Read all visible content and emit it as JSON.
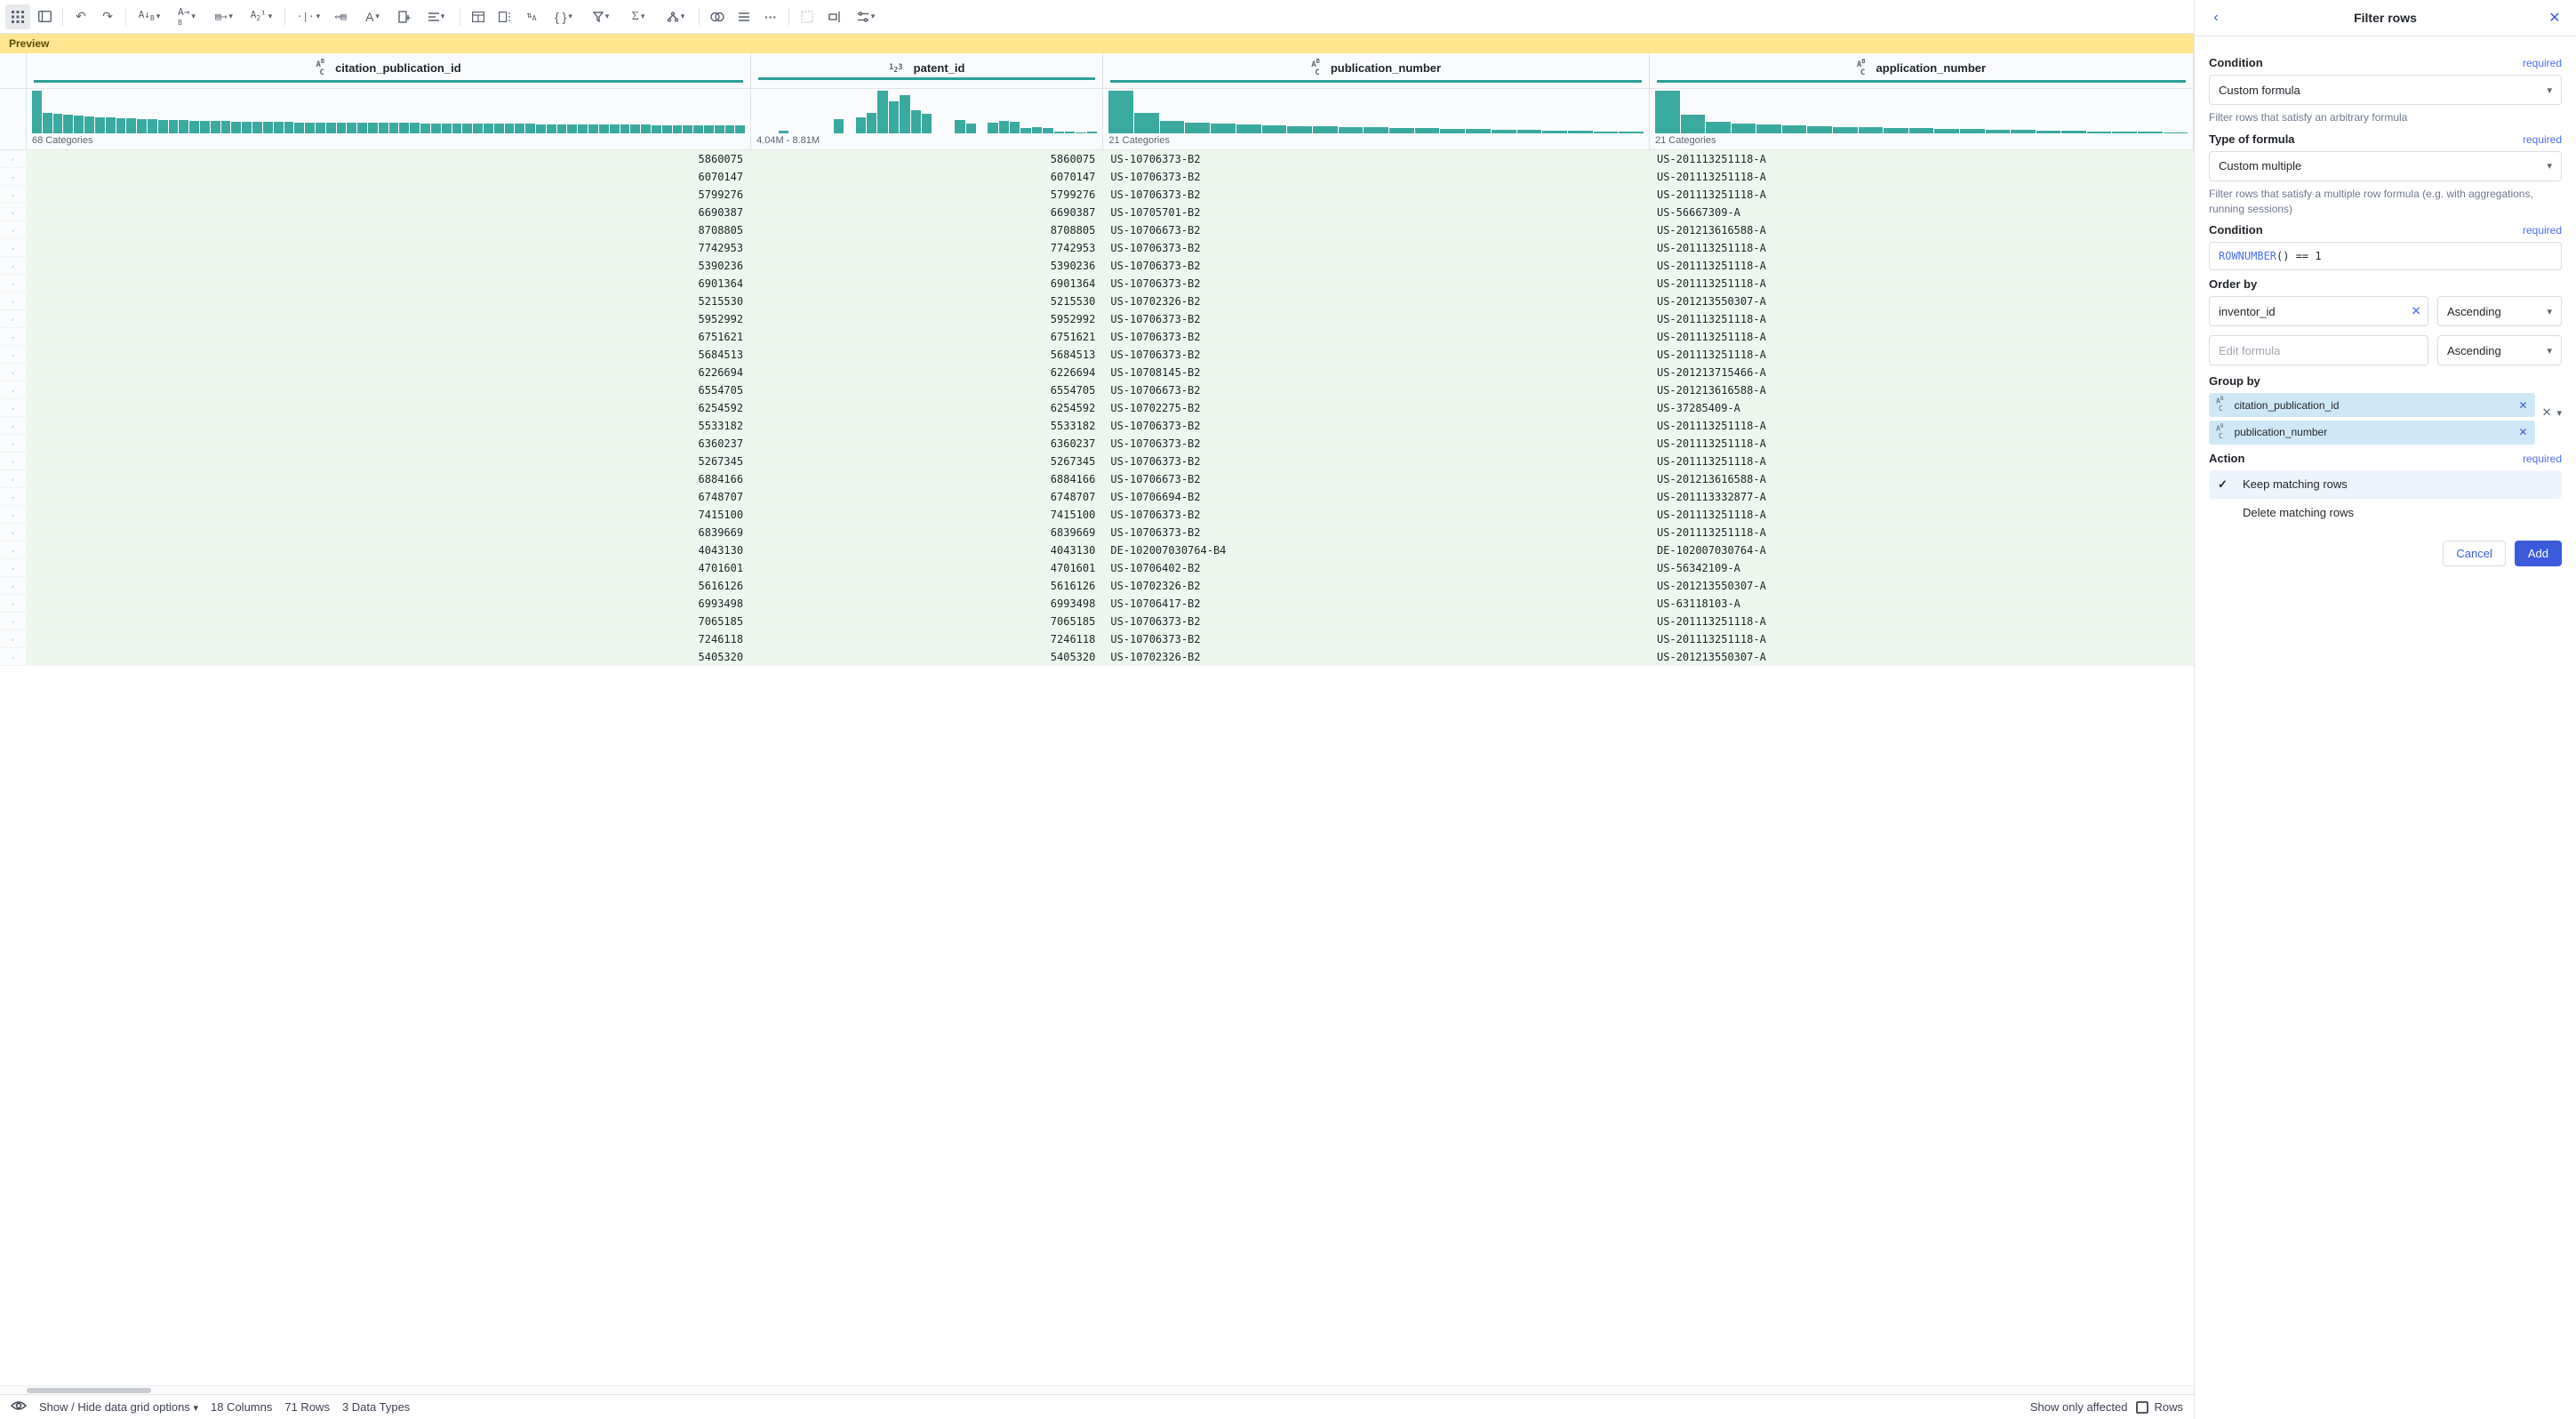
{
  "toolbar": {
    "more_label": "···"
  },
  "preview_banner": "Preview",
  "columns": [
    {
      "name": "citation_publication_id",
      "type": "ABC",
      "summary": "68 Categories",
      "hist": [
        100,
        48,
        46,
        44,
        42,
        40,
        38,
        37,
        36,
        35,
        34,
        33,
        32,
        31,
        31,
        30,
        30,
        29,
        29,
        28,
        28,
        28,
        27,
        27,
        27,
        26,
        26,
        26,
        26,
        25,
        25,
        25,
        25,
        24,
        24,
        24,
        24,
        23,
        23,
        23,
        23,
        23,
        22,
        22,
        22,
        22,
        22,
        22,
        21,
        21,
        21,
        21,
        21,
        20,
        20,
        20,
        20,
        20,
        20,
        19,
        19,
        19,
        19,
        19,
        19,
        18,
        18,
        18
      ]
    },
    {
      "name": "patent_id",
      "type": "123",
      "summary": "4.04M - 8.81M",
      "hist": [
        0,
        0,
        6,
        0,
        0,
        0,
        0,
        34,
        0,
        38,
        48,
        100,
        76,
        90,
        55,
        45,
        0,
        0,
        32,
        22,
        0,
        26,
        30,
        28,
        12,
        15,
        13,
        4,
        5,
        2,
        5
      ]
    },
    {
      "name": "publication_number",
      "type": "ABC",
      "summary": "21 Categories",
      "hist": [
        100,
        48,
        30,
        25,
        22,
        20,
        18,
        17,
        16,
        15,
        14,
        13,
        12,
        11,
        10,
        9,
        8,
        7,
        6,
        5,
        4
      ]
    },
    {
      "name": "application_number",
      "type": "ABC",
      "summary": "21 Categories",
      "hist": [
        100,
        44,
        28,
        22,
        20,
        18,
        16,
        15,
        14,
        13,
        12,
        11,
        10,
        9,
        8,
        7,
        6,
        5,
        4,
        4,
        3
      ]
    }
  ],
  "rows": [
    {
      "c0": "5860075",
      "c1": "5860075",
      "c2": "US-10706373-B2",
      "c3": "US-201113251118-A"
    },
    {
      "c0": "6070147",
      "c1": "6070147",
      "c2": "US-10706373-B2",
      "c3": "US-201113251118-A"
    },
    {
      "c0": "5799276",
      "c1": "5799276",
      "c2": "US-10706373-B2",
      "c3": "US-201113251118-A"
    },
    {
      "c0": "6690387",
      "c1": "6690387",
      "c2": "US-10705701-B2",
      "c3": "US-56667309-A"
    },
    {
      "c0": "8708805",
      "c1": "8708805",
      "c2": "US-10706673-B2",
      "c3": "US-201213616588-A"
    },
    {
      "c0": "7742953",
      "c1": "7742953",
      "c2": "US-10706373-B2",
      "c3": "US-201113251118-A"
    },
    {
      "c0": "5390236",
      "c1": "5390236",
      "c2": "US-10706373-B2",
      "c3": "US-201113251118-A"
    },
    {
      "c0": "6901364",
      "c1": "6901364",
      "c2": "US-10706373-B2",
      "c3": "US-201113251118-A"
    },
    {
      "c0": "5215530",
      "c1": "5215530",
      "c2": "US-10702326-B2",
      "c3": "US-201213550307-A"
    },
    {
      "c0": "5952992",
      "c1": "5952992",
      "c2": "US-10706373-B2",
      "c3": "US-201113251118-A"
    },
    {
      "c0": "6751621",
      "c1": "6751621",
      "c2": "US-10706373-B2",
      "c3": "US-201113251118-A"
    },
    {
      "c0": "5684513",
      "c1": "5684513",
      "c2": "US-10706373-B2",
      "c3": "US-201113251118-A"
    },
    {
      "c0": "6226694",
      "c1": "6226694",
      "c2": "US-10708145-B2",
      "c3": "US-201213715466-A"
    },
    {
      "c0": "6554705",
      "c1": "6554705",
      "c2": "US-10706673-B2",
      "c3": "US-201213616588-A"
    },
    {
      "c0": "6254592",
      "c1": "6254592",
      "c2": "US-10702275-B2",
      "c3": "US-37285409-A"
    },
    {
      "c0": "5533182",
      "c1": "5533182",
      "c2": "US-10706373-B2",
      "c3": "US-201113251118-A"
    },
    {
      "c0": "6360237",
      "c1": "6360237",
      "c2": "US-10706373-B2",
      "c3": "US-201113251118-A"
    },
    {
      "c0": "5267345",
      "c1": "5267345",
      "c2": "US-10706373-B2",
      "c3": "US-201113251118-A"
    },
    {
      "c0": "6884166",
      "c1": "6884166",
      "c2": "US-10706673-B2",
      "c3": "US-201213616588-A"
    },
    {
      "c0": "6748707",
      "c1": "6748707",
      "c2": "US-10706694-B2",
      "c3": "US-201113332877-A"
    },
    {
      "c0": "7415100",
      "c1": "7415100",
      "c2": "US-10706373-B2",
      "c3": "US-201113251118-A"
    },
    {
      "c0": "6839669",
      "c1": "6839669",
      "c2": "US-10706373-B2",
      "c3": "US-201113251118-A"
    },
    {
      "c0": "4043130",
      "c1": "4043130",
      "c2": "DE-102007030764-B4",
      "c3": "DE-102007030764-A"
    },
    {
      "c0": "4701601",
      "c1": "4701601",
      "c2": "US-10706402-B2",
      "c3": "US-56342109-A"
    },
    {
      "c0": "5616126",
      "c1": "5616126",
      "c2": "US-10702326-B2",
      "c3": "US-201213550307-A"
    },
    {
      "c0": "6993498",
      "c1": "6993498",
      "c2": "US-10706417-B2",
      "c3": "US-63118103-A"
    },
    {
      "c0": "7065185",
      "c1": "7065185",
      "c2": "US-10706373-B2",
      "c3": "US-201113251118-A"
    },
    {
      "c0": "7246118",
      "c1": "7246118",
      "c2": "US-10706373-B2",
      "c3": "US-201113251118-A"
    },
    {
      "c0": "5405320",
      "c1": "5405320",
      "c2": "US-10702326-B2",
      "c3": "US-201213550307-A"
    }
  ],
  "footer": {
    "show_hide": "Show / Hide data grid options",
    "cols": "18 Columns",
    "rows": "71 Rows",
    "types": "3 Data Types",
    "show_only": "Show only affected",
    "rows_label": "Rows"
  },
  "side": {
    "title": "Filter rows",
    "condition_label": "Condition",
    "required": "required",
    "condition_select": "Custom formula",
    "condition_hint": "Filter rows that satisfy an arbitrary formula",
    "type_label": "Type of formula",
    "type_select": "Custom multiple",
    "type_hint": "Filter rows that satisfy a multiple row formula (e.g. with aggregations, running sessions)",
    "condition2_label": "Condition",
    "formula_fn": "ROWNUMBER",
    "formula_rest": "() == 1",
    "orderby_label": "Order by",
    "orderby_value": "inventor_id",
    "orderby_dir1": "Ascending",
    "orderby_placeholder": "Edit formula",
    "orderby_dir2": "Ascending",
    "groupby_label": "Group by",
    "group_chips": [
      {
        "type": "ABC",
        "name": "citation_publication_id"
      },
      {
        "type": "ABC",
        "name": "publication_number"
      }
    ],
    "action_label": "Action",
    "action_keep": "Keep matching rows",
    "action_delete": "Delete matching rows",
    "cancel": "Cancel",
    "add": "Add"
  }
}
